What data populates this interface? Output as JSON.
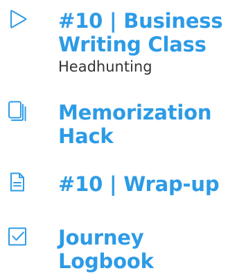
{
  "accent_color": "#2d9be6",
  "subtitle_color": "#333333",
  "items": [
    {
      "icon": "play-outline-icon",
      "title": "#10 | Business Writing Class",
      "subtitle": "Headhunting"
    },
    {
      "icon": "flashcards-icon",
      "title": "Memorization Hack"
    },
    {
      "icon": "document-icon",
      "title": "#10 | Wrap-up"
    },
    {
      "icon": "checkbox-icon",
      "title": "Journey Logbook"
    }
  ]
}
